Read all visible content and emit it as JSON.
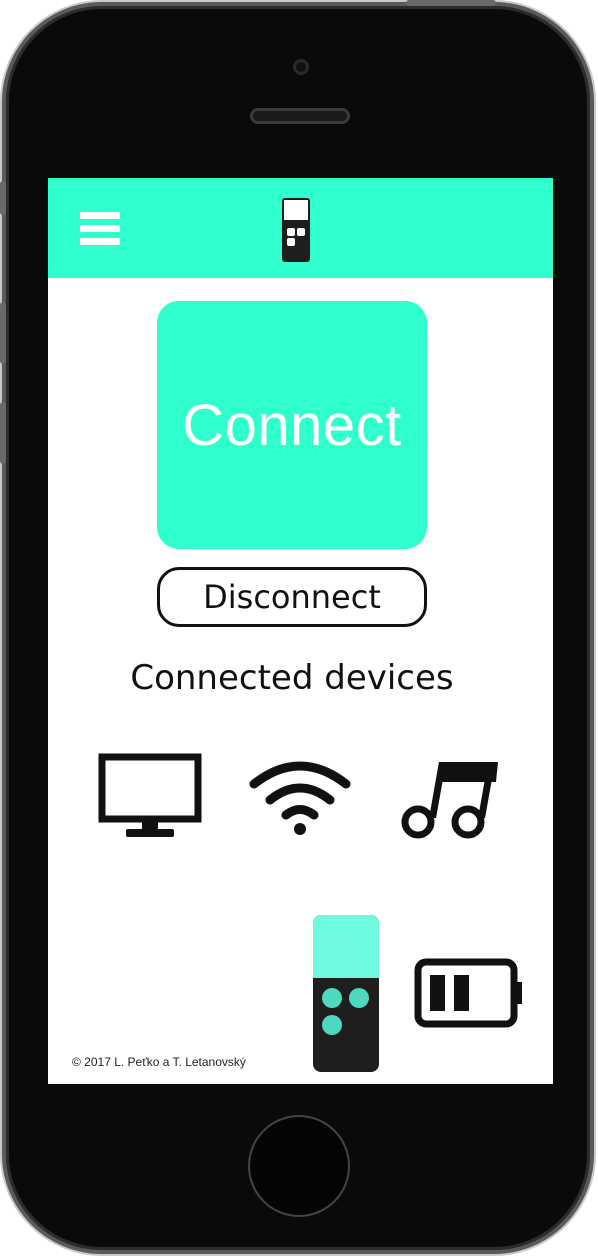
{
  "header": {
    "menu_icon": "hamburger-menu-icon",
    "logo_icon": "remote-logo-icon"
  },
  "main": {
    "connect_label": "Connect",
    "disconnect_label": "Disconnect",
    "devices_title": "Connected devices",
    "devices": [
      {
        "icon": "tv-icon"
      },
      {
        "icon": "wifi-icon"
      },
      {
        "icon": "music-icon"
      }
    ]
  },
  "footer": {
    "copyright": "© 2017 L. Peťko a T. Letanovský",
    "remote_icon": "remote-icon",
    "battery_icon": "battery-icon",
    "battery_level_bars": 2,
    "battery_capacity_bars": 3
  },
  "colors": {
    "accent": "#2fffcc",
    "remote_top": "#6ff9df",
    "remote_buttons": "#4dd9c0",
    "dark": "#1e1e1e"
  }
}
